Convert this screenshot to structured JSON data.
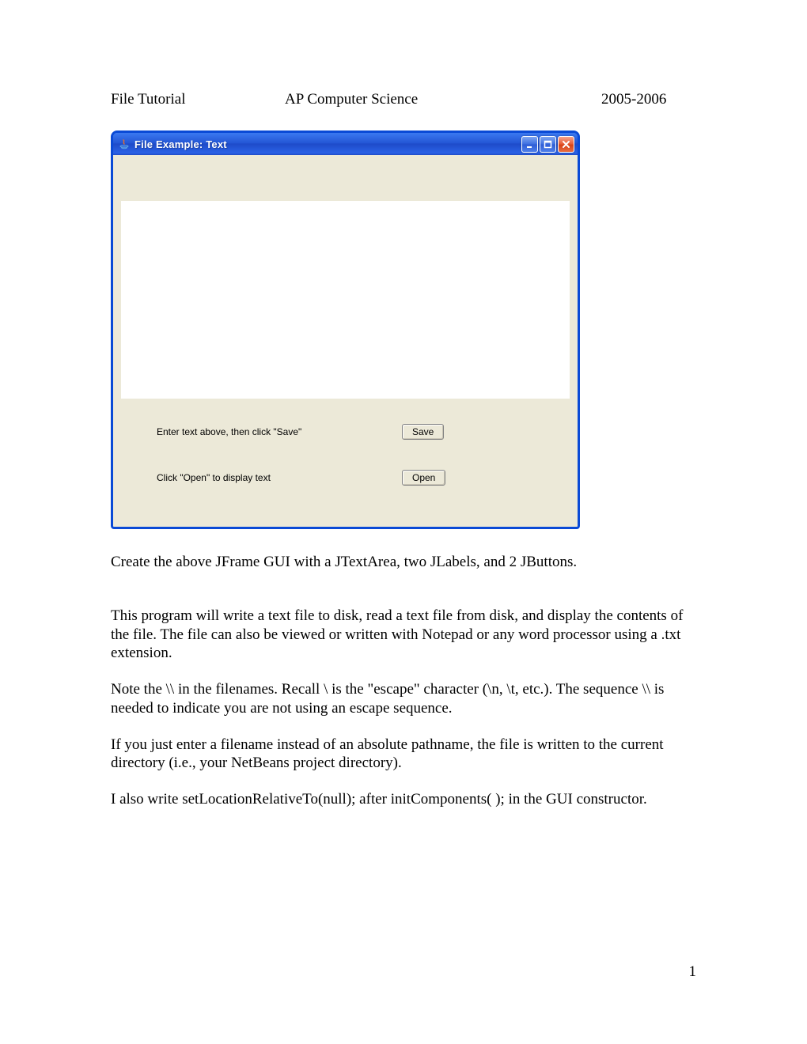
{
  "header": {
    "left": "File Tutorial",
    "center": "AP Computer Science",
    "right": "2005-2006"
  },
  "window": {
    "title": "File Example: Text",
    "label_save": "Enter text above, then click \"Save\"",
    "label_open": "Click \"Open\" to display text",
    "button_save": "Save",
    "button_open": "Open",
    "textarea_value": ""
  },
  "paragraphs": {
    "p1": "Create the above JFrame GUI with a JTextArea, two JLabels, and 2 JButtons.",
    "p2": "This program will write a text file to disk, read a text file from disk, and display the contents of the file. The file can also be viewed or written with Notepad or any word processor using a .txt extension.",
    "p3": "Note the \\\\ in the filenames. Recall \\ is the \"escape\" character (\\n, \\t, etc.). The sequence \\\\ is needed to indicate you are not using an escape sequence.",
    "p4": "If you just enter a filename instead of an absolute pathname, the file is written to the current directory (i.e., your NetBeans project directory).",
    "p5": "I also write setLocationRelativeTo(null); after initComponents( ); in the GUI constructor."
  },
  "page_number": "1"
}
